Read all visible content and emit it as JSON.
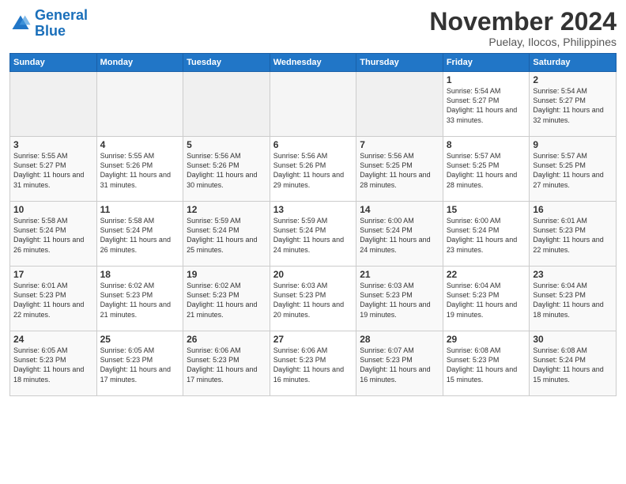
{
  "logo": {
    "line1": "General",
    "line2": "Blue"
  },
  "title": "November 2024",
  "location": "Puelay, Ilocos, Philippines",
  "weekdays": [
    "Sunday",
    "Monday",
    "Tuesday",
    "Wednesday",
    "Thursday",
    "Friday",
    "Saturday"
  ],
  "weeks": [
    [
      {
        "num": "",
        "sunrise": "",
        "sunset": "",
        "daylight": ""
      },
      {
        "num": "",
        "sunrise": "",
        "sunset": "",
        "daylight": ""
      },
      {
        "num": "",
        "sunrise": "",
        "sunset": "",
        "daylight": ""
      },
      {
        "num": "",
        "sunrise": "",
        "sunset": "",
        "daylight": ""
      },
      {
        "num": "",
        "sunrise": "",
        "sunset": "",
        "daylight": ""
      },
      {
        "num": "1",
        "sunrise": "Sunrise: 5:54 AM",
        "sunset": "Sunset: 5:27 PM",
        "daylight": "Daylight: 11 hours and 33 minutes."
      },
      {
        "num": "2",
        "sunrise": "Sunrise: 5:54 AM",
        "sunset": "Sunset: 5:27 PM",
        "daylight": "Daylight: 11 hours and 32 minutes."
      }
    ],
    [
      {
        "num": "3",
        "sunrise": "Sunrise: 5:55 AM",
        "sunset": "Sunset: 5:27 PM",
        "daylight": "Daylight: 11 hours and 31 minutes."
      },
      {
        "num": "4",
        "sunrise": "Sunrise: 5:55 AM",
        "sunset": "Sunset: 5:26 PM",
        "daylight": "Daylight: 11 hours and 31 minutes."
      },
      {
        "num": "5",
        "sunrise": "Sunrise: 5:56 AM",
        "sunset": "Sunset: 5:26 PM",
        "daylight": "Daylight: 11 hours and 30 minutes."
      },
      {
        "num": "6",
        "sunrise": "Sunrise: 5:56 AM",
        "sunset": "Sunset: 5:26 PM",
        "daylight": "Daylight: 11 hours and 29 minutes."
      },
      {
        "num": "7",
        "sunrise": "Sunrise: 5:56 AM",
        "sunset": "Sunset: 5:25 PM",
        "daylight": "Daylight: 11 hours and 28 minutes."
      },
      {
        "num": "8",
        "sunrise": "Sunrise: 5:57 AM",
        "sunset": "Sunset: 5:25 PM",
        "daylight": "Daylight: 11 hours and 28 minutes."
      },
      {
        "num": "9",
        "sunrise": "Sunrise: 5:57 AM",
        "sunset": "Sunset: 5:25 PM",
        "daylight": "Daylight: 11 hours and 27 minutes."
      }
    ],
    [
      {
        "num": "10",
        "sunrise": "Sunrise: 5:58 AM",
        "sunset": "Sunset: 5:24 PM",
        "daylight": "Daylight: 11 hours and 26 minutes."
      },
      {
        "num": "11",
        "sunrise": "Sunrise: 5:58 AM",
        "sunset": "Sunset: 5:24 PM",
        "daylight": "Daylight: 11 hours and 26 minutes."
      },
      {
        "num": "12",
        "sunrise": "Sunrise: 5:59 AM",
        "sunset": "Sunset: 5:24 PM",
        "daylight": "Daylight: 11 hours and 25 minutes."
      },
      {
        "num": "13",
        "sunrise": "Sunrise: 5:59 AM",
        "sunset": "Sunset: 5:24 PM",
        "daylight": "Daylight: 11 hours and 24 minutes."
      },
      {
        "num": "14",
        "sunrise": "Sunrise: 6:00 AM",
        "sunset": "Sunset: 5:24 PM",
        "daylight": "Daylight: 11 hours and 24 minutes."
      },
      {
        "num": "15",
        "sunrise": "Sunrise: 6:00 AM",
        "sunset": "Sunset: 5:24 PM",
        "daylight": "Daylight: 11 hours and 23 minutes."
      },
      {
        "num": "16",
        "sunrise": "Sunrise: 6:01 AM",
        "sunset": "Sunset: 5:23 PM",
        "daylight": "Daylight: 11 hours and 22 minutes."
      }
    ],
    [
      {
        "num": "17",
        "sunrise": "Sunrise: 6:01 AM",
        "sunset": "Sunset: 5:23 PM",
        "daylight": "Daylight: 11 hours and 22 minutes."
      },
      {
        "num": "18",
        "sunrise": "Sunrise: 6:02 AM",
        "sunset": "Sunset: 5:23 PM",
        "daylight": "Daylight: 11 hours and 21 minutes."
      },
      {
        "num": "19",
        "sunrise": "Sunrise: 6:02 AM",
        "sunset": "Sunset: 5:23 PM",
        "daylight": "Daylight: 11 hours and 21 minutes."
      },
      {
        "num": "20",
        "sunrise": "Sunrise: 6:03 AM",
        "sunset": "Sunset: 5:23 PM",
        "daylight": "Daylight: 11 hours and 20 minutes."
      },
      {
        "num": "21",
        "sunrise": "Sunrise: 6:03 AM",
        "sunset": "Sunset: 5:23 PM",
        "daylight": "Daylight: 11 hours and 19 minutes."
      },
      {
        "num": "22",
        "sunrise": "Sunrise: 6:04 AM",
        "sunset": "Sunset: 5:23 PM",
        "daylight": "Daylight: 11 hours and 19 minutes."
      },
      {
        "num": "23",
        "sunrise": "Sunrise: 6:04 AM",
        "sunset": "Sunset: 5:23 PM",
        "daylight": "Daylight: 11 hours and 18 minutes."
      }
    ],
    [
      {
        "num": "24",
        "sunrise": "Sunrise: 6:05 AM",
        "sunset": "Sunset: 5:23 PM",
        "daylight": "Daylight: 11 hours and 18 minutes."
      },
      {
        "num": "25",
        "sunrise": "Sunrise: 6:05 AM",
        "sunset": "Sunset: 5:23 PM",
        "daylight": "Daylight: 11 hours and 17 minutes."
      },
      {
        "num": "26",
        "sunrise": "Sunrise: 6:06 AM",
        "sunset": "Sunset: 5:23 PM",
        "daylight": "Daylight: 11 hours and 17 minutes."
      },
      {
        "num": "27",
        "sunrise": "Sunrise: 6:06 AM",
        "sunset": "Sunset: 5:23 PM",
        "daylight": "Daylight: 11 hours and 16 minutes."
      },
      {
        "num": "28",
        "sunrise": "Sunrise: 6:07 AM",
        "sunset": "Sunset: 5:23 PM",
        "daylight": "Daylight: 11 hours and 16 minutes."
      },
      {
        "num": "29",
        "sunrise": "Sunrise: 6:08 AM",
        "sunset": "Sunset: 5:23 PM",
        "daylight": "Daylight: 11 hours and 15 minutes."
      },
      {
        "num": "30",
        "sunrise": "Sunrise: 6:08 AM",
        "sunset": "Sunset: 5:24 PM",
        "daylight": "Daylight: 11 hours and 15 minutes."
      }
    ]
  ]
}
